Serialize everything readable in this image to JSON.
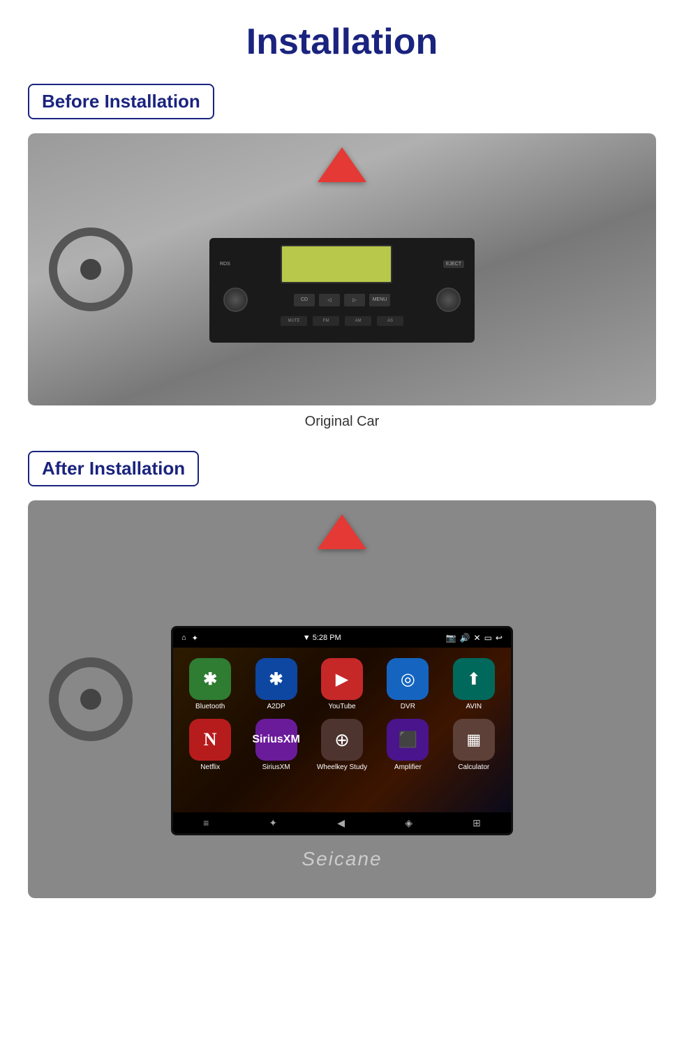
{
  "page": {
    "title": "Installation"
  },
  "before_section": {
    "badge": "Before Installation",
    "caption": "Original Car"
  },
  "after_section": {
    "badge": "After Installation"
  },
  "head_unit": {
    "statusbar": {
      "home_icon": "⌂",
      "wifi_icon": "✦",
      "time": "▼ 5:28 PM",
      "icons_right": [
        "📷",
        "🔊",
        "✕",
        "▭",
        "↩"
      ]
    },
    "apps_row1": [
      {
        "label": "Bluetooth",
        "icon": "✱",
        "bg": "bg-green"
      },
      {
        "label": "A2DP",
        "icon": "✱",
        "bg": "bg-blue-bt"
      },
      {
        "label": "YouTube",
        "icon": "▶",
        "bg": "bg-red-yt"
      },
      {
        "label": "DVR",
        "icon": "◎",
        "bg": "bg-blue-dvr"
      },
      {
        "label": "AVIN",
        "icon": "⬆",
        "bg": "bg-teal"
      }
    ],
    "apps_row2": [
      {
        "label": "Netflix",
        "icon": "N",
        "bg": "bg-red-nf"
      },
      {
        "label": "SiriusXM",
        "icon": "S",
        "bg": "bg-purple-sx"
      },
      {
        "label": "Wheelkey Study",
        "icon": "⊕",
        "bg": "bg-brown-wk"
      },
      {
        "label": "Amplifier",
        "icon": "⬛",
        "bg": "bg-purple-amp"
      },
      {
        "label": "Calculator",
        "icon": "▦",
        "bg": "bg-brown-calc"
      }
    ],
    "navbar": [
      "≡",
      "✦",
      "◀",
      "◈",
      "⊞"
    ]
  },
  "seicane_brand": "Seicane"
}
